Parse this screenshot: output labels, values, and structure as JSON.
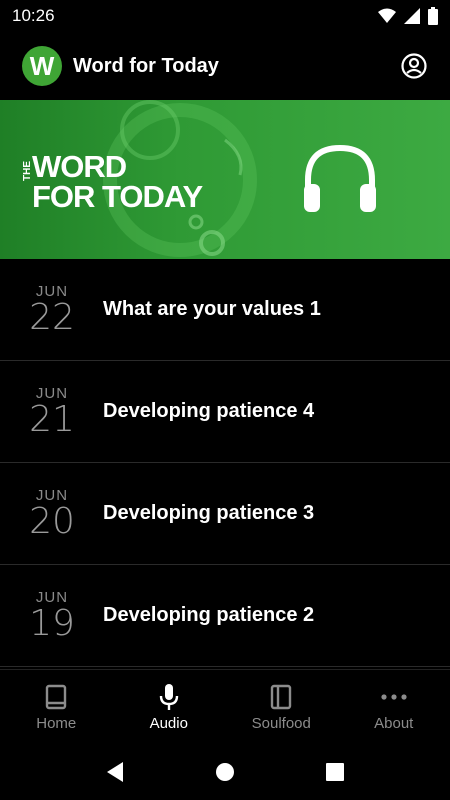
{
  "status_bar": {
    "time": "10:26"
  },
  "header": {
    "logo_letter": "W",
    "title": "Word for Today"
  },
  "banner": {
    "line_the": "THE",
    "line1": "WORD",
    "line2": "FOR TODAY"
  },
  "list": [
    {
      "month": "JUN",
      "day": "22",
      "title": "What are your values 1"
    },
    {
      "month": "JUN",
      "day": "21",
      "title": "Developing patience 4"
    },
    {
      "month": "JUN",
      "day": "20",
      "title": "Developing patience 3"
    },
    {
      "month": "JUN",
      "day": "19",
      "title": "Developing patience 2"
    }
  ],
  "nav": {
    "home": "Home",
    "audio": "Audio",
    "soulfood": "Soulfood",
    "about": "About",
    "active": "audio"
  },
  "colors": {
    "brand_green": "#3fa535",
    "background": "#000000",
    "inactive": "#8c8c8c"
  }
}
